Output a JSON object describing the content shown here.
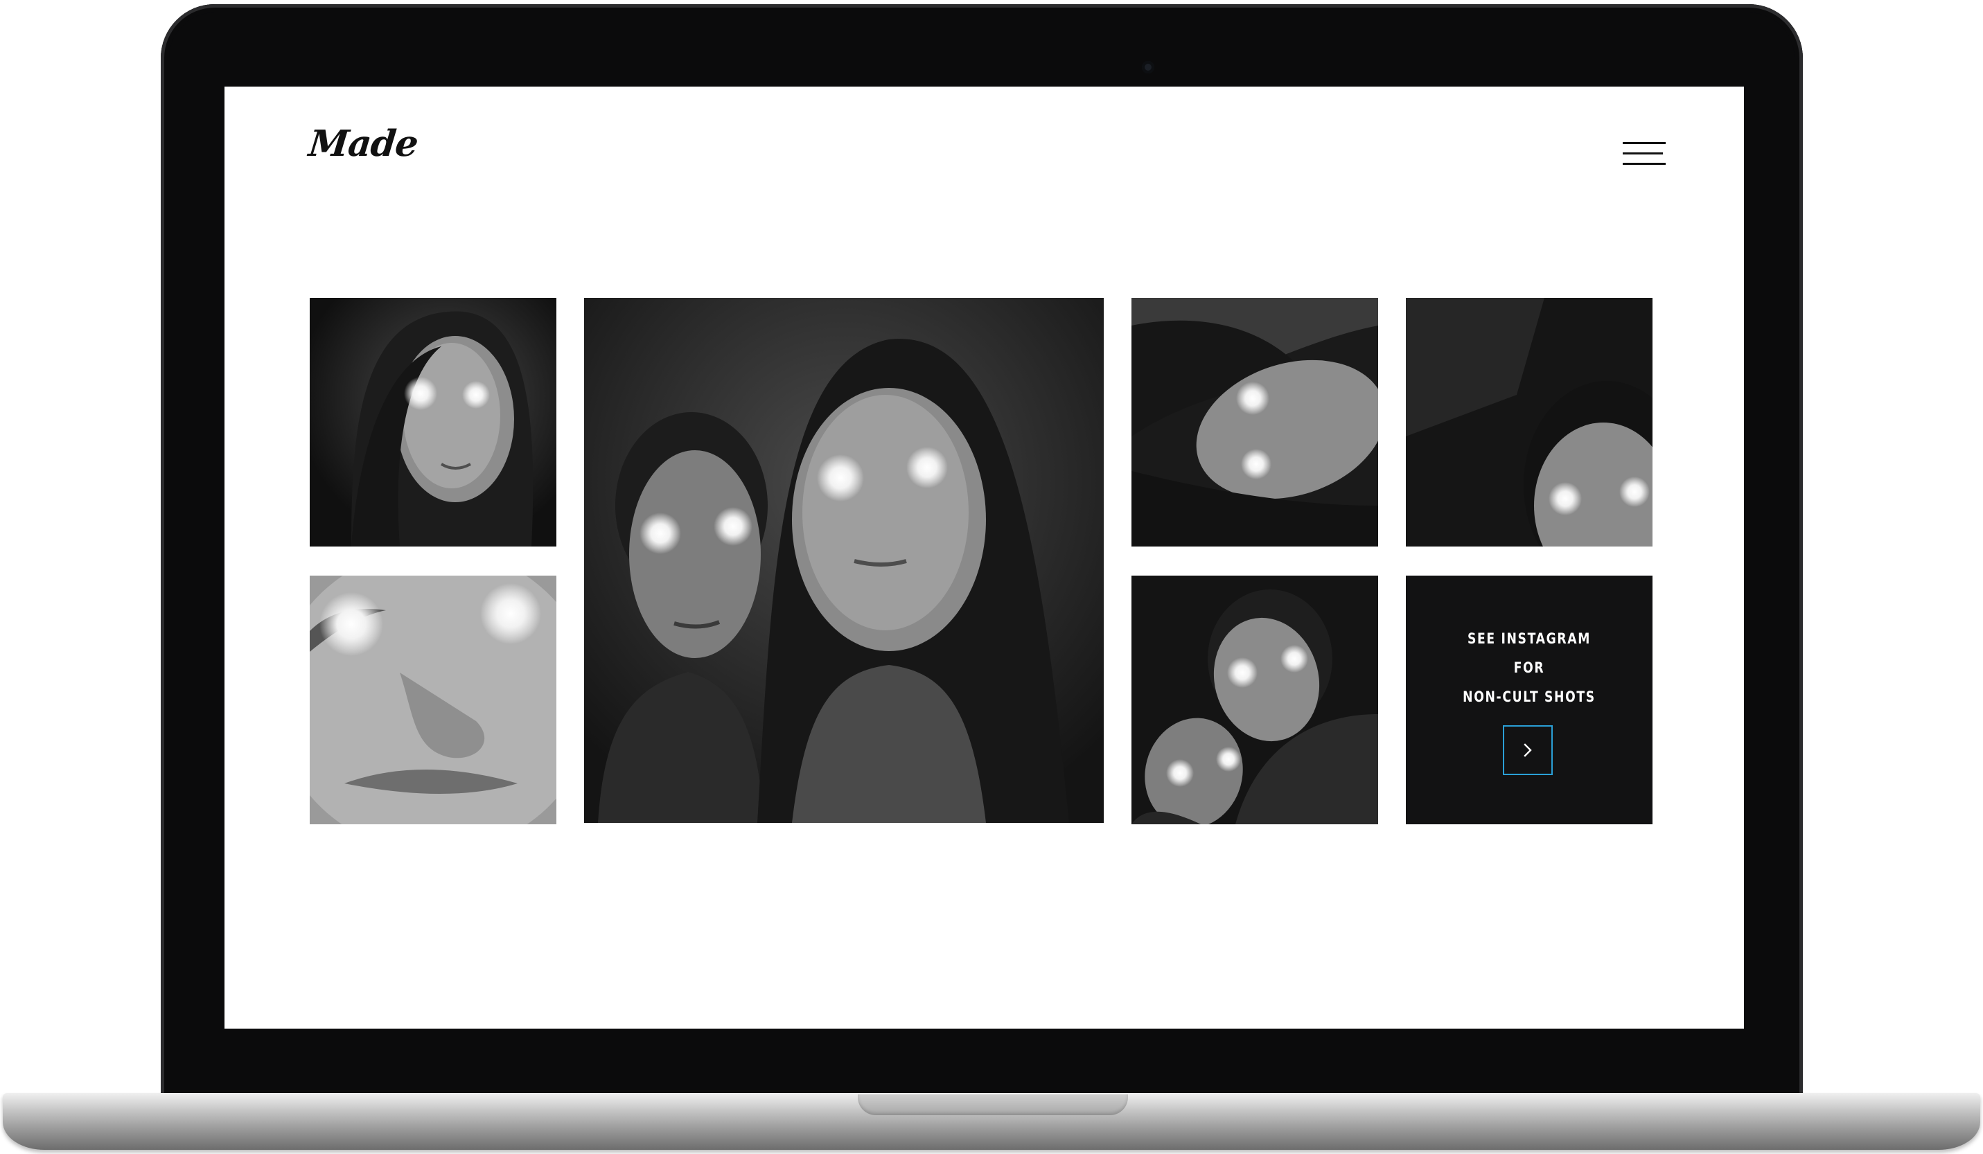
{
  "site": {
    "logo": "Made"
  },
  "header": {
    "menu_icon": "hamburger-menu-icon"
  },
  "gallery": {
    "tiles": [
      {
        "subject": "woman-glowing-eyes"
      },
      {
        "subject": "face-closeup-glowing-eyes"
      },
      {
        "subject": "man-and-woman-glowing-eyes"
      },
      {
        "subject": "woman-tilted-glowing-eyes"
      },
      {
        "subject": "man-glowing-eyes"
      },
      {
        "subject": "two-men-glowing-eyes"
      }
    ],
    "cta": {
      "line1": "SEE INSTAGRAM",
      "line2": "FOR",
      "line3": "NON-CULT SHOTS",
      "arrow_icon": "chevron-right-icon",
      "accent_color": "#2a9fd6"
    }
  }
}
